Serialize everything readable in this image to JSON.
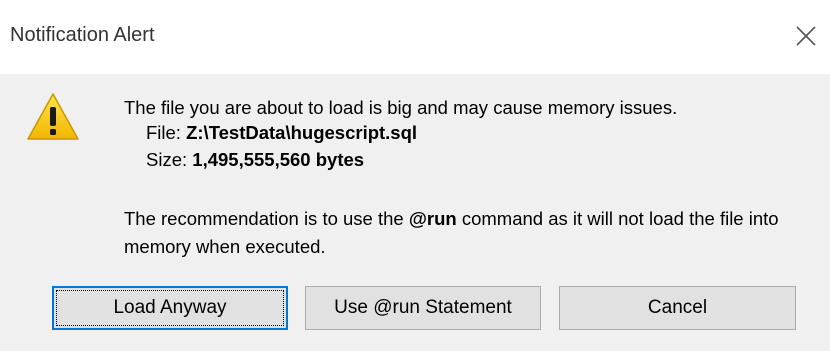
{
  "window": {
    "title": "Notification Alert",
    "close_icon": "close-icon"
  },
  "message": {
    "icon": "warning-icon",
    "line1": "The file you are about to load is big and may cause memory issues.",
    "file_label": "File:",
    "file_value": "Z:\\TestData\\hugescript.sql",
    "size_label": "Size:",
    "size_value": "1,495,555,560 bytes",
    "rec_before": "The recommendation is to use the ",
    "rec_command": "@run",
    "rec_after": " command as it will not load the file into memory when executed."
  },
  "buttons": {
    "load_anyway": "Load Anyway",
    "use_run": "Use @run Statement",
    "cancel": "Cancel"
  },
  "colors": {
    "title_bg": "#ffffff",
    "body_bg": "#f0f0f0",
    "button_bg": "#e1e1e1",
    "default_border": "#0078d7",
    "warning_yellow": "#f5c400"
  }
}
